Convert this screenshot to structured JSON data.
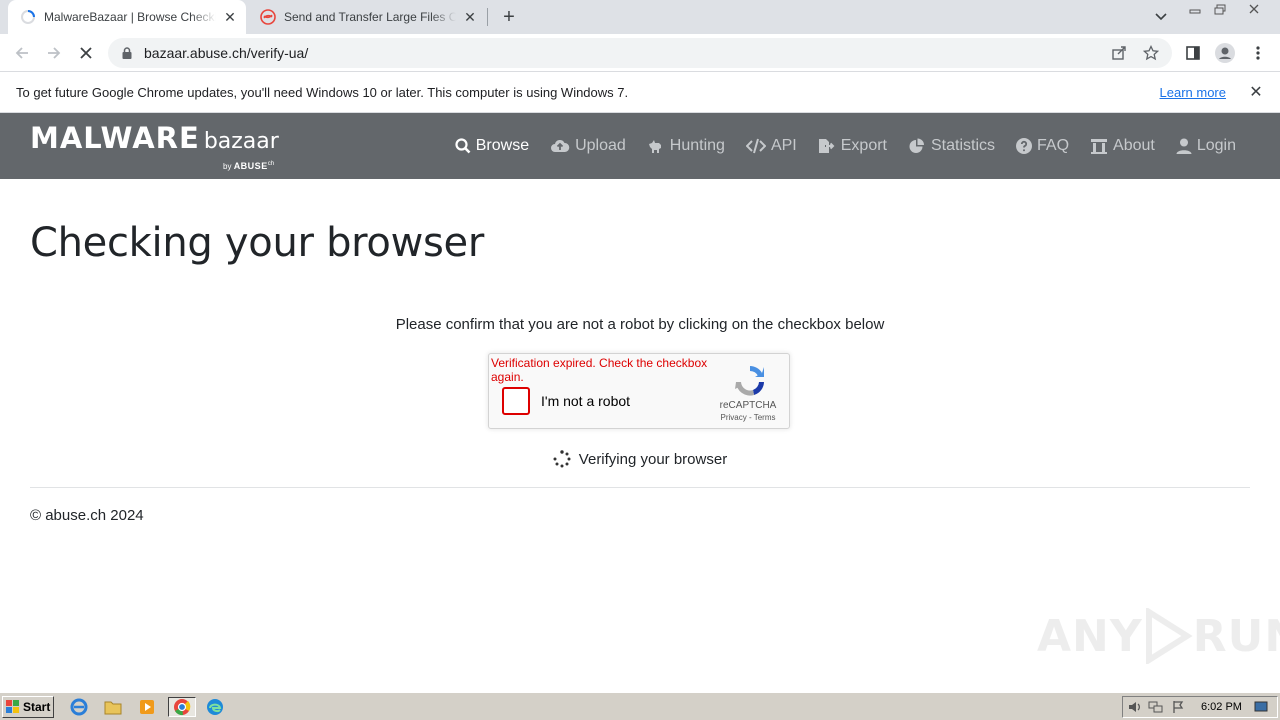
{
  "browser": {
    "tabs": [
      {
        "title": "MalwareBazaar | Browse Checking y",
        "active": true
      },
      {
        "title": "Send and Transfer Large Files Online",
        "active": false
      }
    ],
    "url": "bazaar.abuse.ch/verify-ua/",
    "infobar": {
      "message": "To get future Google Chrome updates, you'll need Windows 10 or later. This computer is using Windows 7.",
      "learn_more": "Learn more"
    }
  },
  "site": {
    "brand": {
      "part1": "MALWARE",
      "part2": "bazaar",
      "by": "by",
      "org": "ABUSE",
      "org_suffix": "ch"
    },
    "nav": {
      "browse": "Browse",
      "upload": "Upload",
      "hunting": "Hunting",
      "api": "API",
      "export": "Export",
      "statistics": "Statistics",
      "faq": "FAQ",
      "about": "About",
      "login": "Login"
    },
    "page_title": "Checking your browser",
    "confirm_text": "Please confirm that you are not a robot by clicking on the checkbox below",
    "recaptcha": {
      "error": "Verification expired. Check the checkbox again.",
      "label": "I'm not a robot",
      "brand": "reCAPTCHA",
      "links": "Privacy - Terms"
    },
    "verifying_text": "Verifying your browser",
    "footer": "© abuse.ch 2024"
  },
  "watermark": {
    "left": "ANY",
    "right": "RUN"
  },
  "taskbar": {
    "start": "Start",
    "clock": "6:02 PM"
  },
  "colors": {
    "navbar": "#63676b",
    "error": "#dd0000",
    "link": "#1a73e8"
  }
}
